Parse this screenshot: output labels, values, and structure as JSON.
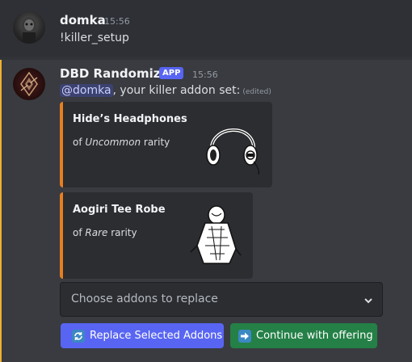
{
  "messages": [
    {
      "username": "domka",
      "timestamp": "15:56",
      "content": "!killer_setup"
    },
    {
      "username": "DBD Randomizer",
      "badge": "APP",
      "timestamp": "15:56",
      "mention": "@domka",
      "content_rest": ", your killer addon set:",
      "edited": "(edited)",
      "embeds": [
        {
          "title": "Hide’s Headphones",
          "desc_prefix": "of",
          "rarity": "Uncommon",
          "desc_suffix": "rarity",
          "accent": "#e67e22",
          "thumbnail_icon": "headphones-icon"
        },
        {
          "title": "Aogiri Tee Robe",
          "desc_prefix": "of",
          "rarity": "Rare",
          "desc_suffix": "rarity",
          "accent": "#e67e22",
          "thumbnail_icon": "robe-icon"
        }
      ],
      "select": {
        "placeholder": "Choose addons to replace"
      },
      "buttons": [
        {
          "label": "Replace Selected Addons",
          "icon": "refresh-icon",
          "color": "#5865f2"
        },
        {
          "label": "Continue with offering",
          "icon": "arrow-right-icon",
          "color": "#248046"
        }
      ]
    }
  ]
}
